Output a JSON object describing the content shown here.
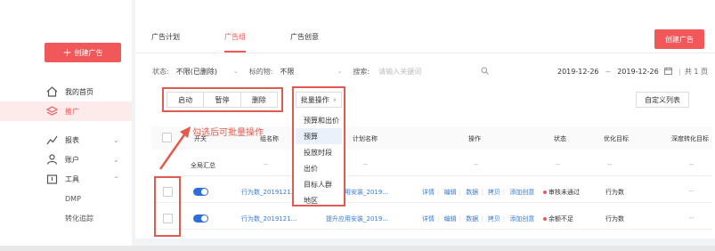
{
  "sidebar": {
    "create_label": "创建广告",
    "items": [
      {
        "label": "我的首页",
        "icon": "home-icon"
      },
      {
        "label": "推广",
        "icon": "layers-icon",
        "active": true
      },
      {
        "label": "报表",
        "icon": "chart-icon"
      },
      {
        "label": "账户",
        "icon": "user-icon"
      },
      {
        "label": "工具",
        "icon": "toolbox-icon"
      }
    ],
    "sub_items": [
      "DMP",
      "转化追踪"
    ]
  },
  "header": {
    "tabs": [
      "广告计划",
      "广告组",
      "广告创意"
    ],
    "active_tab": "广告组",
    "create_group_label": "创建广告"
  },
  "filters": {
    "status_label": "状态:",
    "status_value": "不限(已删除)",
    "target_label": "标的物:",
    "target_value": "不限",
    "search_label": "搜索:",
    "search_placeholder": "请输入关键词",
    "date_start": "2019-12-26",
    "date_sep": "~",
    "date_end": "2019-12-26",
    "total": "共 1 页"
  },
  "toolbar": {
    "start": "启动",
    "pause": "暂停",
    "delete": "删除",
    "batch": "批量操作",
    "custom_cols": "自定义列表"
  },
  "dropdown": {
    "items": [
      "预算和出价",
      "预算",
      "投放时段",
      "出价",
      "目标人群",
      "地区"
    ],
    "active_index": 1
  },
  "annotation": "勾选后可批量操作",
  "table": {
    "headers": {
      "switch": "开关",
      "group_name": "组名称",
      "plan_name": "计划名称",
      "ops": "操作",
      "status": "状态",
      "goal": "优化目标",
      "deep": "深度转化目标"
    },
    "summary": {
      "label": "全局汇总",
      "dash": "--"
    },
    "rows": [
      {
        "group": "行为数_2019121...",
        "plan": "提升应用安装_2019...",
        "ops": [
          "详情",
          "编辑",
          "数据",
          "拷贝",
          "添加创意"
        ],
        "status": "审核未通过",
        "goal": "行为数",
        "deep": "--"
      },
      {
        "group": "行为数_2019121...",
        "plan": "提升应用安装_2019...",
        "ops": [
          "详情",
          "编辑",
          "数据",
          "拷贝",
          "添加创意"
        ],
        "status": "余额不足",
        "goal": "行为数",
        "deep": "--"
      }
    ]
  },
  "colors": {
    "accent": "#f0585a",
    "link": "#3a7bd5",
    "annotation": "#e05a4e"
  }
}
